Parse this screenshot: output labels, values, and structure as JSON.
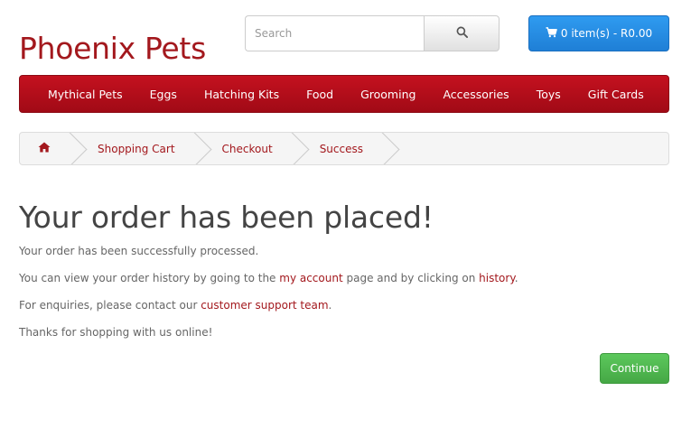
{
  "header": {
    "logo_text": "Phoenix Pets",
    "search_placeholder": "Search",
    "cart_label": "0 item(s) - R0.00",
    "search_icon": "search-icon",
    "cart_icon": "shopping-cart-icon"
  },
  "menu": {
    "items": [
      {
        "label": "Mythical Pets"
      },
      {
        "label": "Eggs"
      },
      {
        "label": "Hatching Kits"
      },
      {
        "label": "Food"
      },
      {
        "label": "Grooming"
      },
      {
        "label": "Accessories"
      },
      {
        "label": "Toys"
      },
      {
        "label": "Gift Cards"
      }
    ]
  },
  "breadcrumb": {
    "home_icon": "home-icon",
    "items": [
      {
        "label": "Shopping Cart"
      },
      {
        "label": "Checkout"
      },
      {
        "label": "Success"
      }
    ]
  },
  "content": {
    "title": "Your order has been placed!",
    "line1": "Your order has been successfully processed.",
    "line2_pre": "You can view your order history by going to the ",
    "line2_link1": "my account",
    "line2_mid": " page and by clicking on ",
    "line2_link2": "history",
    "line2_post": ".",
    "line3_pre": "For enquiries, please contact our ",
    "line3_link": "customer support team",
    "line3_post": ".",
    "line4": "Thanks for shopping with us online!",
    "continue_label": "Continue"
  },
  "colors": {
    "brand": "#a3181d",
    "menu_bg": "#b50e1b",
    "cart_button": "#2389e3",
    "continue_button": "#4cb84c"
  }
}
